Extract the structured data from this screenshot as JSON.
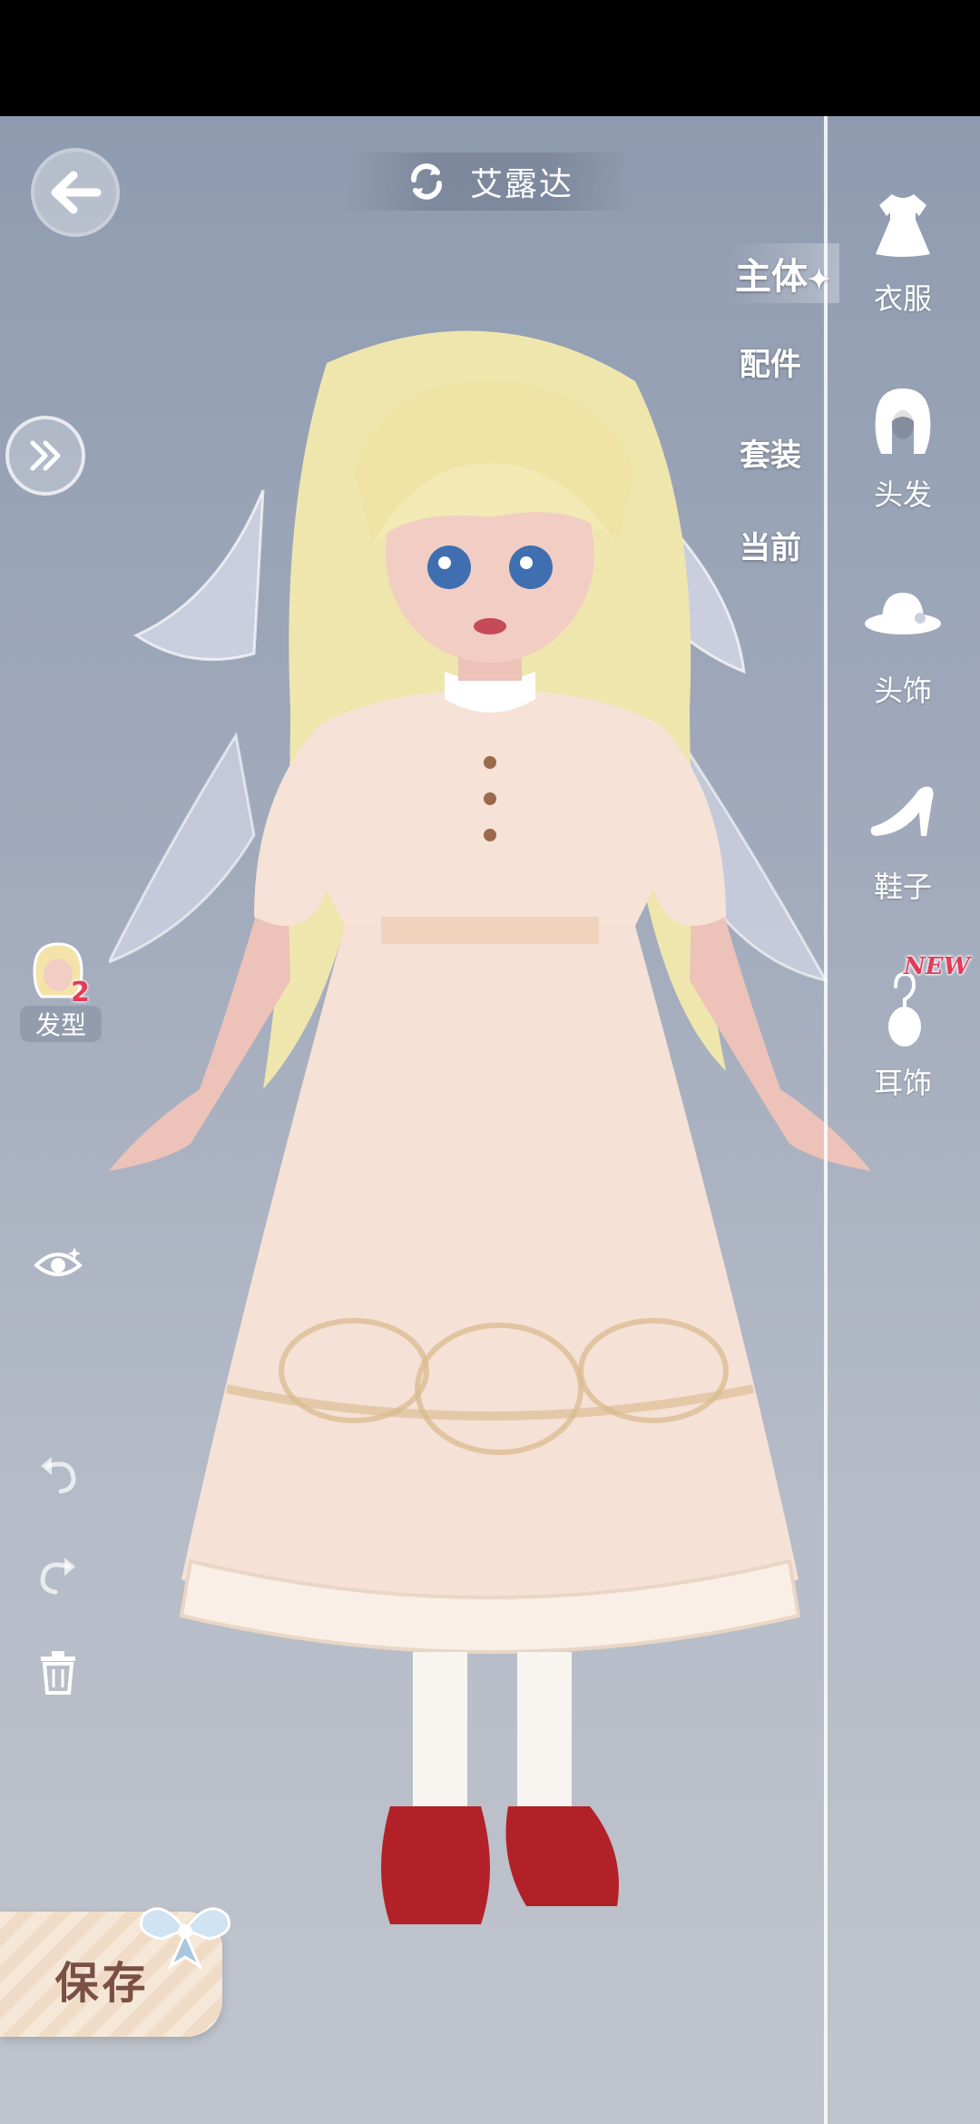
{
  "header": {
    "character_name": "艾露达"
  },
  "categories": [
    {
      "label": "衣服",
      "icon": "dress-icon"
    },
    {
      "label": "头发",
      "icon": "hair-icon"
    },
    {
      "label": "头饰",
      "icon": "hat-icon"
    },
    {
      "label": "鞋子",
      "icon": "shoe-icon"
    },
    {
      "label": "耳饰",
      "icon": "earring-icon",
      "badge": "NEW"
    }
  ],
  "subtabs": [
    "主体",
    "配件",
    "套装",
    "当前"
  ],
  "active_subtab": "主体",
  "left_tools": {
    "hairstyle_label": "发型",
    "hairstyle_count": "2"
  },
  "footer": {
    "save_label": "保存"
  },
  "colors": {
    "accent": "#e23c5b",
    "panel_line": "#ffffff",
    "save_text": "#7a4f44"
  }
}
